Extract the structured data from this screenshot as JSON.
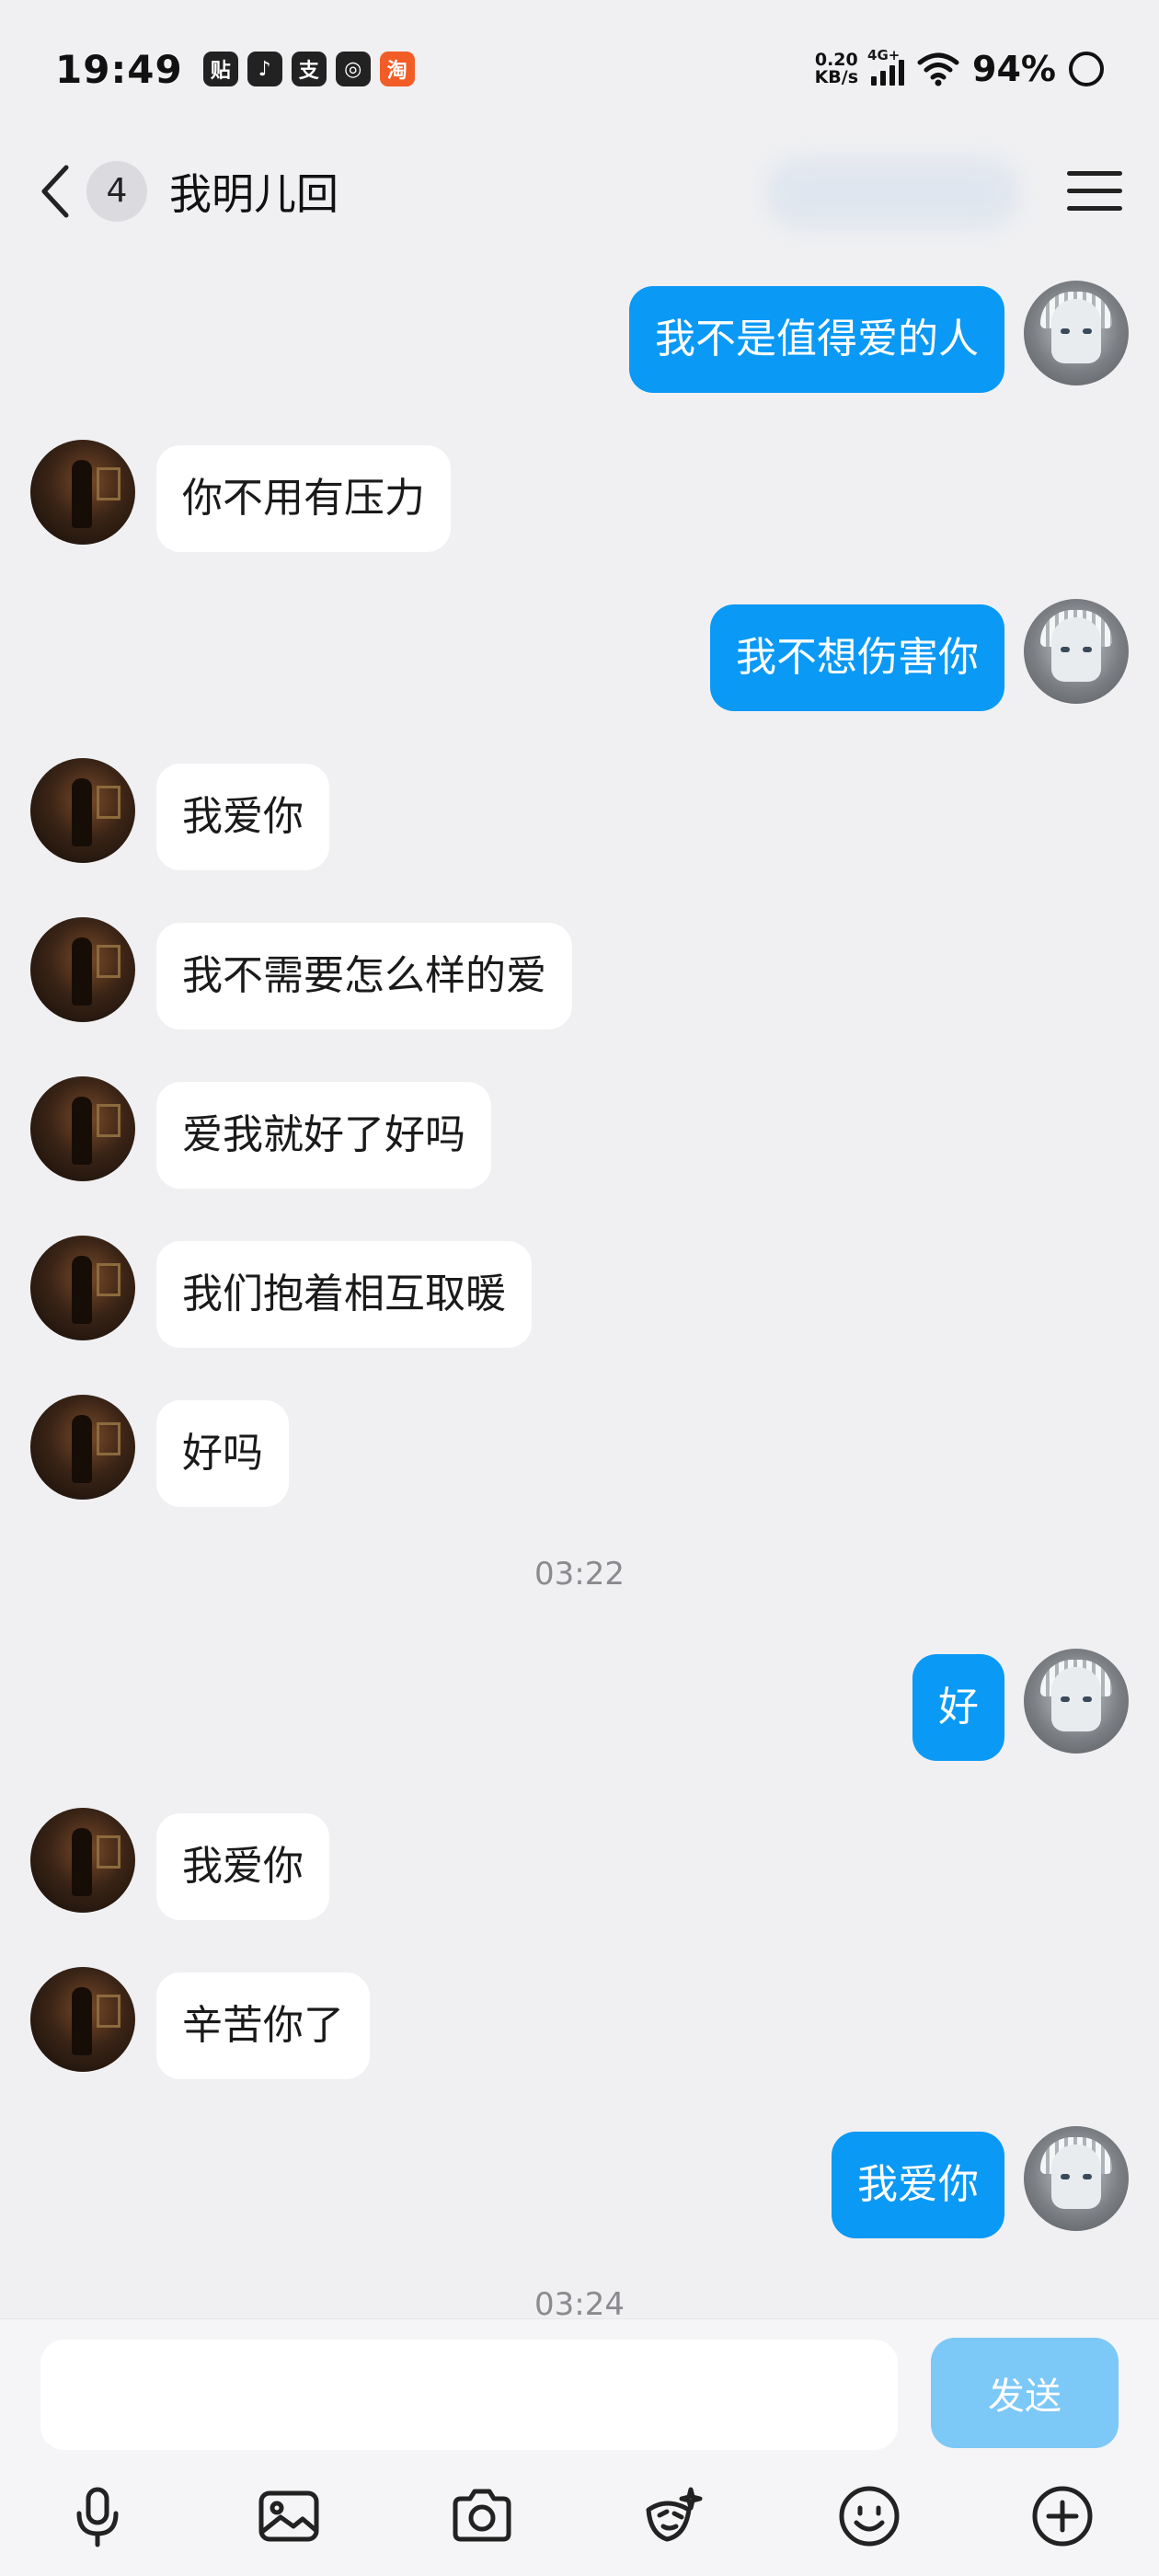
{
  "status_bar": {
    "time": "19:49",
    "app_icons": [
      "tieba-icon",
      "douyin-icon",
      "alipay-icon",
      "wechat-icon",
      "taobao-icon"
    ],
    "net_speed_value": "0.20",
    "net_speed_unit": "KB/s",
    "network": "4G+",
    "battery": "94%"
  },
  "header": {
    "unread_count": "4",
    "title": "我明儿回"
  },
  "messages": [
    {
      "side": "out",
      "text": "我不是值得爱的人"
    },
    {
      "side": "in",
      "text": "你不用有压力"
    },
    {
      "side": "out",
      "text": "我不想伤害你"
    },
    {
      "side": "in",
      "text": "我爱你"
    },
    {
      "side": "in",
      "text": "我不需要怎么样的爱"
    },
    {
      "side": "in",
      "text": "爱我就好了好吗"
    },
    {
      "side": "in",
      "text": "我们抱着相互取暖"
    },
    {
      "side": "in",
      "text": "好吗"
    },
    {
      "side": "out",
      "text": "好"
    },
    {
      "side": "in",
      "text": "我爱你"
    },
    {
      "side": "in",
      "text": "辛苦你了"
    },
    {
      "side": "out",
      "text": "我爱你"
    }
  ],
  "timestamps": [
    "03:22",
    "03:24"
  ],
  "input": {
    "value": "",
    "send_label": "发送"
  },
  "colors": {
    "outgoing_bubble": "#0a99f5",
    "incoming_bubble": "#ffffff",
    "background": "#f0f0f2",
    "send_button": "#7cc8f7"
  },
  "toolbar": [
    "microphone-icon",
    "image-icon",
    "camera-icon",
    "sticker-icon",
    "emoji-icon",
    "plus-icon"
  ]
}
